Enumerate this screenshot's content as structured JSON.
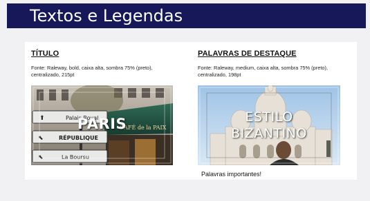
{
  "header": {
    "title": "Textos e Legendas"
  },
  "left": {
    "title": "TÍTULO",
    "description": "Fonte: Raleway, bold, caixa alta, sombra 75% (preto), centralizado, 215pt",
    "image_text": "PARIS",
    "signs": [
      "Palais Royal",
      "RÉPUBLIQUE",
      "La Boursu"
    ],
    "cafe_sign": "CAFÉ de la PAIX"
  },
  "right": {
    "title": "PALAVRAS DE DESTAQUE",
    "description": "Fonte: Raleway, medium, caixa alta, sombra 75% (preto), centralizado, 198pt",
    "image_text_line1": "ESTILO",
    "image_text_line2": "BIZANTINO",
    "note": "Palavras importantes!"
  },
  "colors": {
    "header_bg": "#17185a",
    "page_bg": "#f1f1f3",
    "card_bg": "#ffffff"
  }
}
